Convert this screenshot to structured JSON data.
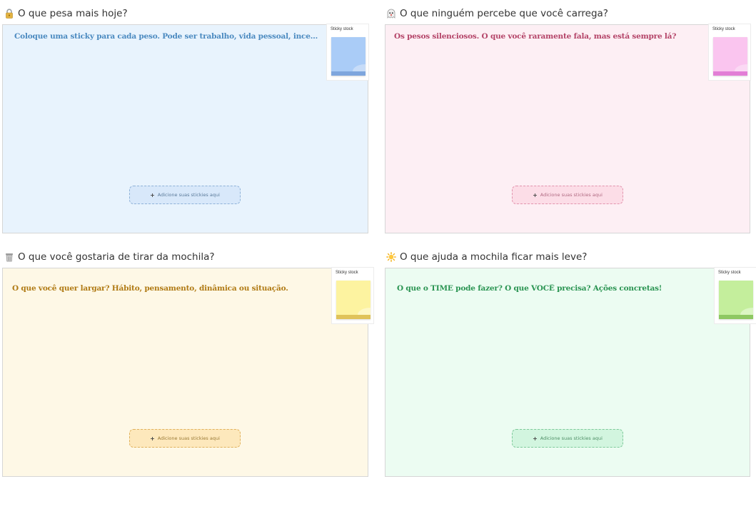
{
  "sections": [
    {
      "icon": "lock-icon",
      "title": "O que pesa mais hoje?",
      "prompt": "Coloque uma sticky para cada peso. Pode ser trabalho, vida pessoal, incertezas...",
      "stock_label": "Sticky stock",
      "add_label": "Adicione suas stickies aqui",
      "color": "#e8f3fd",
      "sticky_color": "#aaccf7"
    },
    {
      "icon": "ghost-icon",
      "title": "O que ninguém percebe que você carrega?",
      "prompt": "Os pesos silenciosos. O que você raramente fala, mas está sempre lá?",
      "stock_label": "Sticky stock",
      "add_label": "Adicione suas stickies aqui",
      "color": "#fdeff4",
      "sticky_color": "#fac5ef"
    },
    {
      "icon": "trash-can-icon",
      "title": "O que você gostaria de tirar da mochila?",
      "prompt": "O que você quer largar? Hábito, pensamento, dinâmica ou situação.",
      "stock_label": "Sticky stock",
      "add_label": "Adicione suas stickies aqui",
      "color": "#fef8e6",
      "sticky_color": "#fdf3a0"
    },
    {
      "icon": "sun-icon",
      "title": "O que ajuda a mochila ficar mais leve?",
      "prompt": "O que o TIME pode fazer? O que VOCÊ precisa? Ações concretas!",
      "stock_label": "Sticky stock",
      "add_label": "Adicione suas stickies aqui",
      "color": "#ecfcf2",
      "sticky_color": "#c4ee9c"
    }
  ]
}
